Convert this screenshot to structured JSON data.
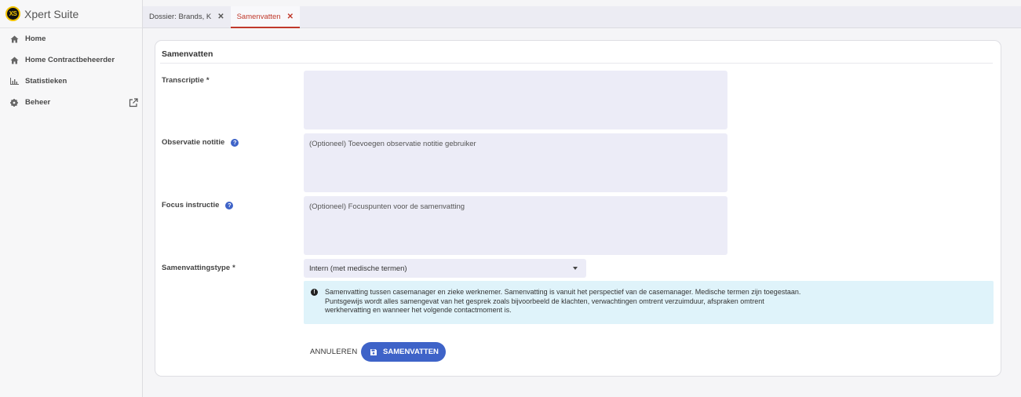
{
  "app": {
    "logo_text": "XS",
    "name": "Xpert Suite"
  },
  "sidebar": {
    "items": [
      {
        "label": "Home",
        "icon": "home-icon"
      },
      {
        "label": "Home Contractbeheerder",
        "icon": "home-icon"
      },
      {
        "label": "Statistieken",
        "icon": "bar-chart-icon"
      },
      {
        "label": "Beheer",
        "icon": "gear-icon",
        "trailing_icon": "external-link-icon"
      }
    ]
  },
  "tabs": [
    {
      "label": "Dossier: Brands, K",
      "close": "✕",
      "active": false
    },
    {
      "label": "Samenvatten",
      "close": "✕",
      "active": true
    }
  ],
  "form": {
    "title": "Samenvatten",
    "transcriptie": {
      "label": "Transcriptie",
      "required": "*",
      "value": "",
      "placeholder": ""
    },
    "observatie": {
      "label": "Observatie notitie",
      "help": "?",
      "placeholder": "(Optioneel) Toevoegen observatie notitie gebruiker"
    },
    "focus": {
      "label": "Focus instructie",
      "help": "?",
      "placeholder": "(Optioneel) Focuspunten voor de samenvatting"
    },
    "type": {
      "label": "Samenvattingstype",
      "required": "*",
      "selected": "Intern (met medische termen)"
    },
    "info": {
      "icon": "!",
      "lines": [
        "Samenvatting tussen casemanager en zieke werknemer. Samenvatting is vanuit het perspectief van de casemanager. Medische termen zijn toegestaan.",
        "Puntsgewijs wordt alles samengevat van het gesprek zoals bijvoorbeeld de klachten, verwachtingen omtrent verzuimduur, afspraken omtrent",
        "werkhervatting en wanneer het volgende contactmoment is."
      ]
    },
    "cancel_label": "ANNULEREN",
    "submit_label": "SAMENVATTEN"
  },
  "colors": {
    "primary": "#3e63c8",
    "active_tab": "#c0392b",
    "info_bg": "#dff3fa",
    "field_bg": "#ececf7",
    "logo_yellow": "#f2c200"
  }
}
